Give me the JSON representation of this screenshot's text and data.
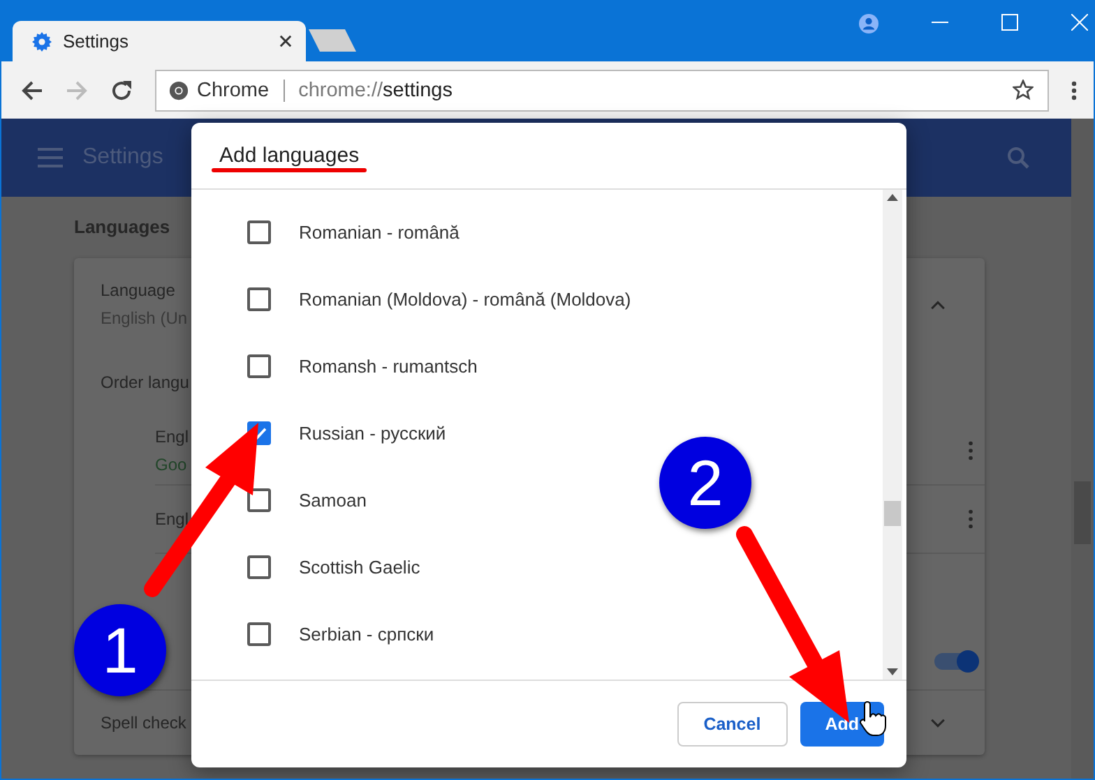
{
  "tab": {
    "title": "Settings"
  },
  "address_bar": {
    "site_label": "Chrome",
    "url_scheme": "chrome://",
    "url_path": "settings"
  },
  "settings_header": {
    "title": "Settings"
  },
  "languages_section": {
    "heading": "Languages",
    "language_label": "Language",
    "language_value": "English (Un",
    "order_label": "Order langu",
    "languages": [
      {
        "name": "Engl",
        "note": "Goo"
      },
      {
        "name": "Engl"
      }
    ],
    "translate_toggle": {
      "on": true
    },
    "spell_check_label": "Spell check"
  },
  "dialog": {
    "title": "Add languages",
    "options": [
      {
        "label": "Romanian - română",
        "checked": false
      },
      {
        "label": "Romanian (Moldova) - română (Moldova)",
        "checked": false
      },
      {
        "label": "Romansh - rumantsch",
        "checked": false
      },
      {
        "label": "Russian - русский",
        "checked": true
      },
      {
        "label": "Samoan",
        "checked": false
      },
      {
        "label": "Scottish Gaelic",
        "checked": false
      },
      {
        "label": "Serbian - српски",
        "checked": false
      }
    ],
    "buttons": [
      {
        "label": "Cancel",
        "kind": "secondary"
      },
      {
        "label": "Add",
        "kind": "primary"
      }
    ]
  },
  "annotations": [
    {
      "number": "1"
    },
    {
      "number": "2"
    }
  ]
}
